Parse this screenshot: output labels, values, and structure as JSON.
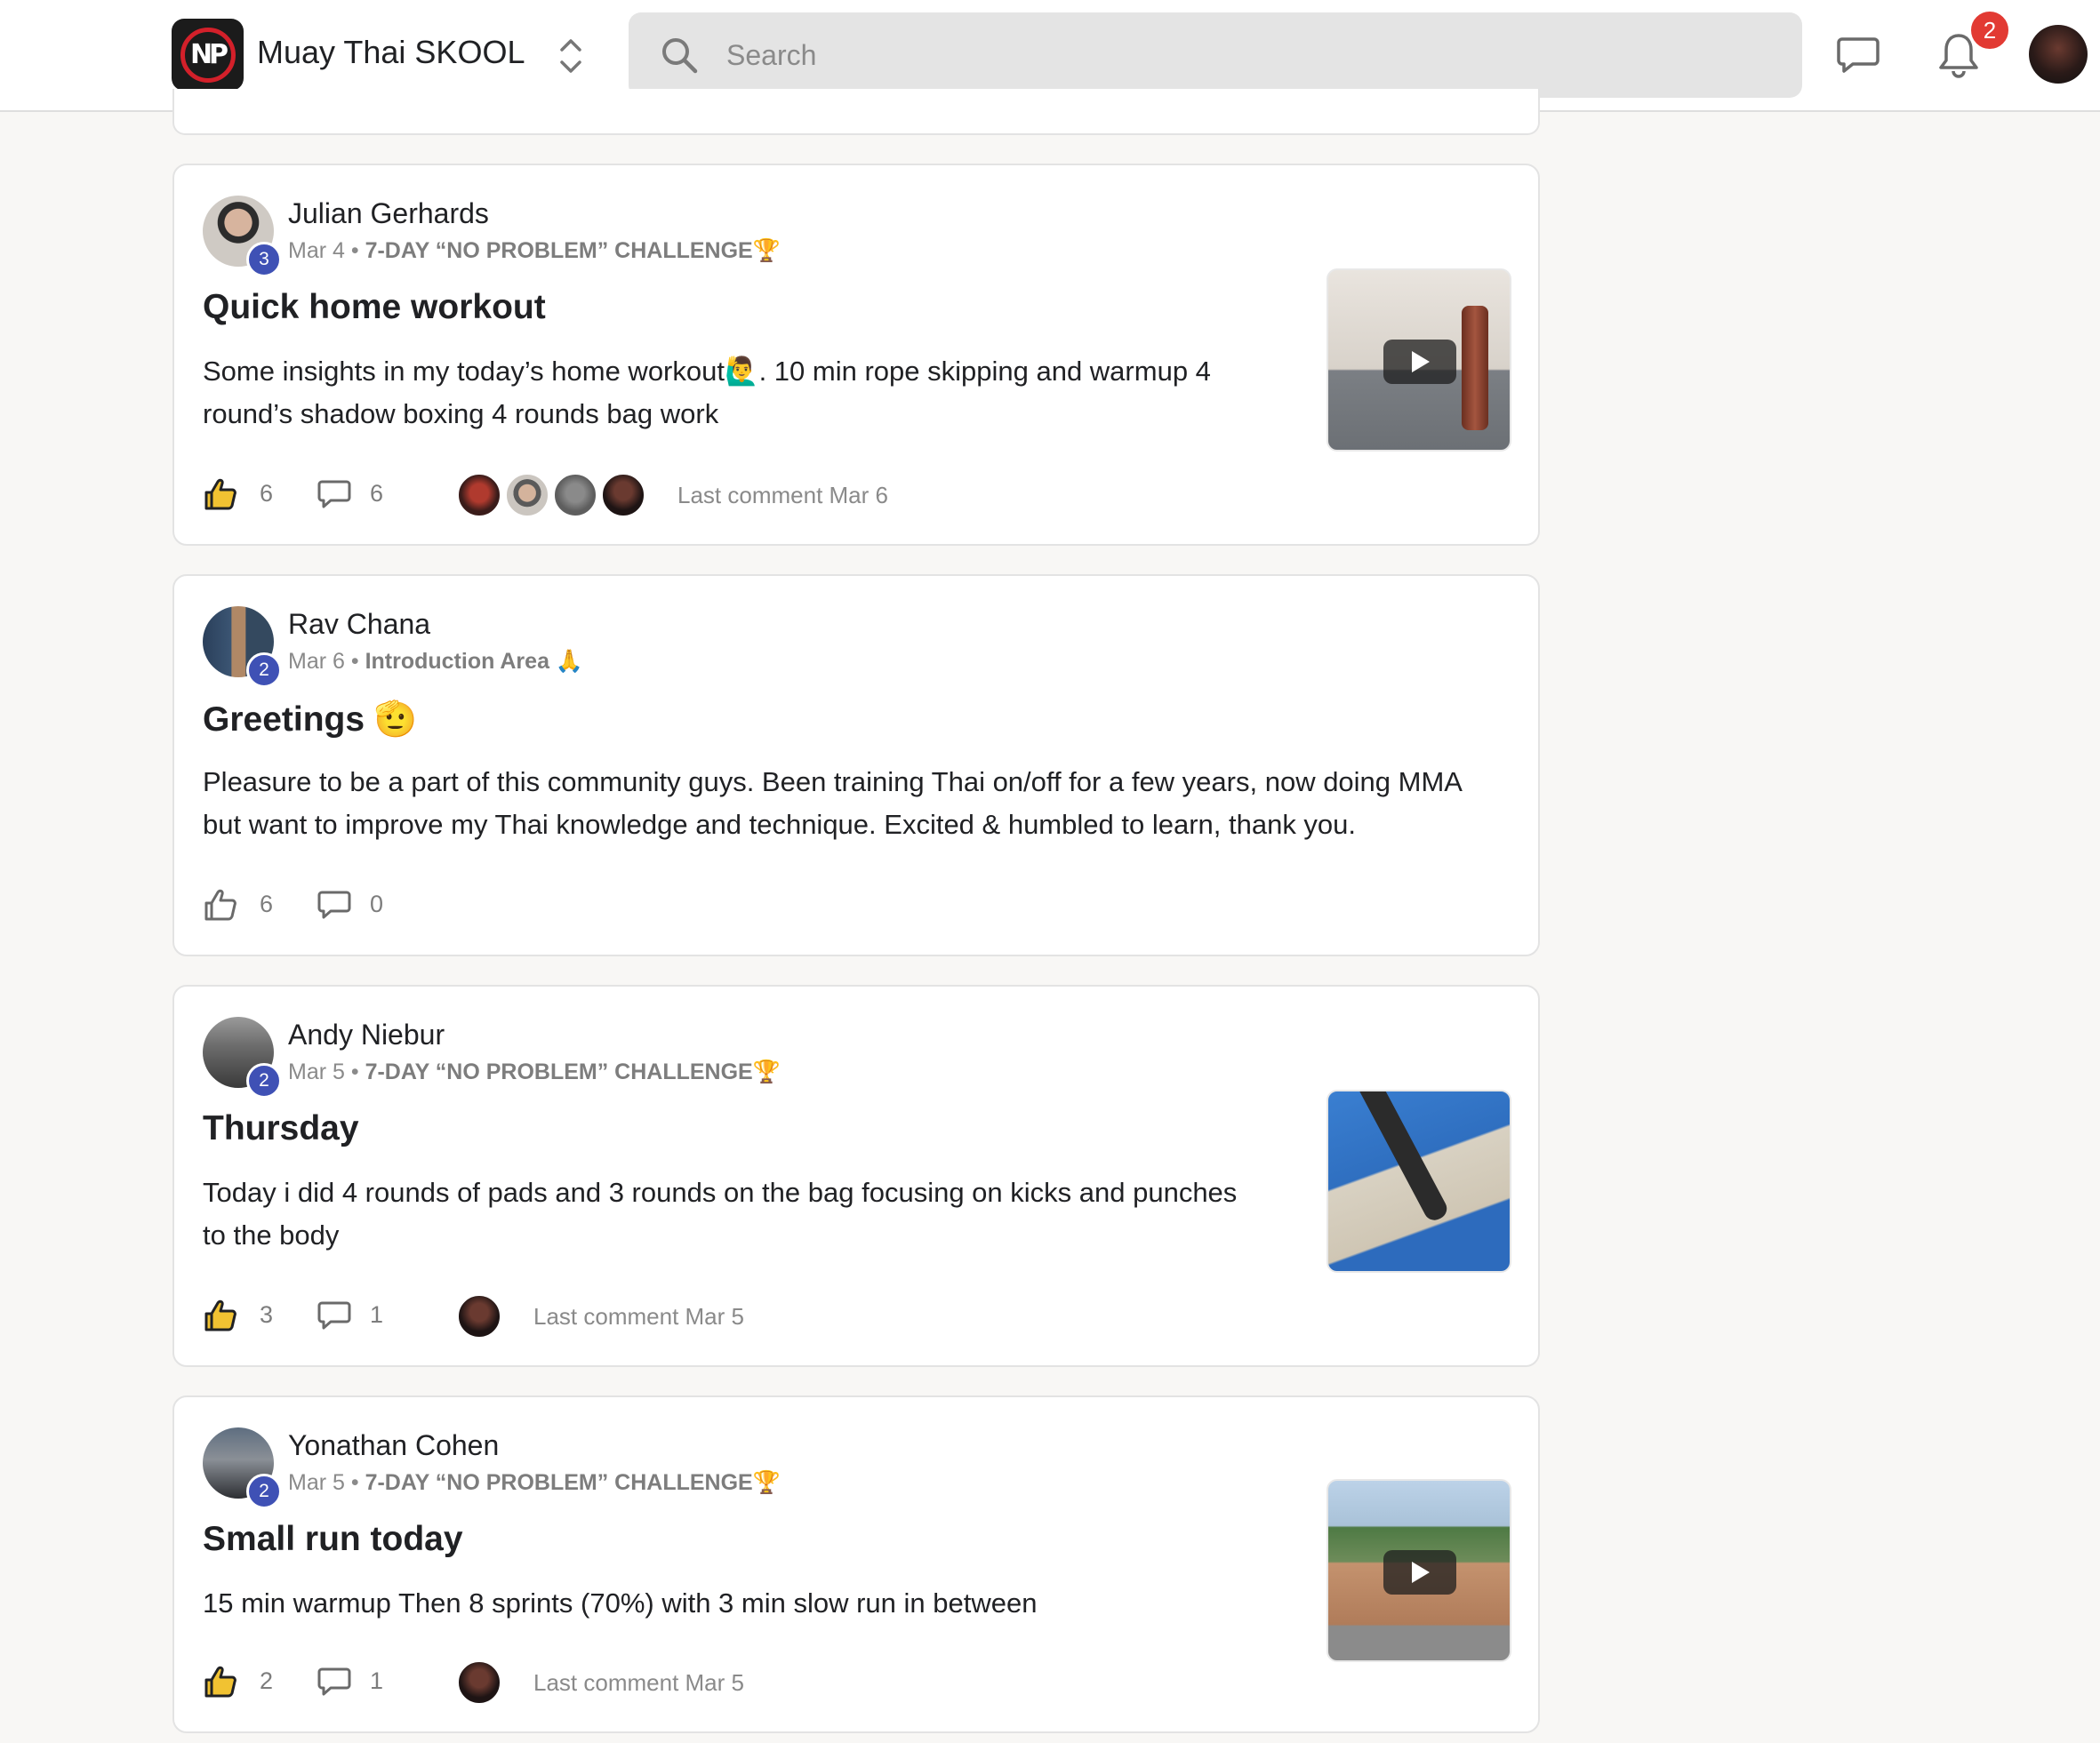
{
  "header": {
    "group_name": "Muay Thai SKOOL",
    "search_placeholder": "Search",
    "notification_count": "2"
  },
  "posts": [
    {
      "author": "Julian Gerhards",
      "level": "3",
      "date": "Mar 4",
      "separator": " • ",
      "category": "7-DAY “NO PROBLEM” CHALLENGE🏆",
      "title": "Quick home workout",
      "body_line1": "Some insights in my today’s home workout🙋‍♂️. 10 min rope skipping and warmup 4",
      "body_line2": "round’s shadow boxing 4 rounds bag work",
      "likes": "6",
      "comments": "6",
      "last_comment": "Last comment Mar 6",
      "liked": true,
      "has_video": true
    },
    {
      "author": "Rav Chana",
      "level": "2",
      "date": "Mar 6",
      "separator": " • ",
      "category": "Introduction Area 🙏",
      "title": "Greetings 🫡",
      "body_line1": "Pleasure to be a part of this community guys. Been training Thai on/off for a few years, now doing MMA",
      "body_line2": "but want to improve my Thai knowledge and technique. Excited & humbled to learn, thank you.",
      "likes": "6",
      "comments": "0",
      "liked": false
    },
    {
      "author": "Andy Niebur",
      "level": "2",
      "date": "Mar 5",
      "separator": " • ",
      "category": "7-DAY “NO PROBLEM” CHALLENGE🏆",
      "title": "Thursday",
      "body_line1": "Today i did 4 rounds of pads and 3 rounds on the bag focusing on kicks and punches",
      "body_line2": "to the body",
      "likes": "3",
      "comments": "1",
      "last_comment": "Last comment Mar 5",
      "liked": true,
      "has_video": false
    },
    {
      "author": "Yonathan Cohen",
      "level": "2",
      "date": "Mar 5",
      "separator": " • ",
      "category": "7-DAY “NO PROBLEM” CHALLENGE🏆",
      "title": "Small run today",
      "body_line1": "15 min warmup Then 8 sprints (70%) with 3 min slow run in between",
      "likes": "2",
      "comments": "1",
      "last_comment": "Last comment Mar 5",
      "liked": true,
      "has_video": true
    }
  ],
  "icons": {
    "like": "thumbs-up-icon",
    "comment": "comment-icon",
    "search": "search-icon",
    "chat": "chat-icon",
    "bell": "bell-icon",
    "play": "play-icon",
    "switcher": "chevron-up-down-icon"
  },
  "colors": {
    "level_badge": "#3f51b5",
    "notification_badge": "#e23a33",
    "liked_icon": "#202124",
    "muted_text": "#8a8a8a"
  }
}
